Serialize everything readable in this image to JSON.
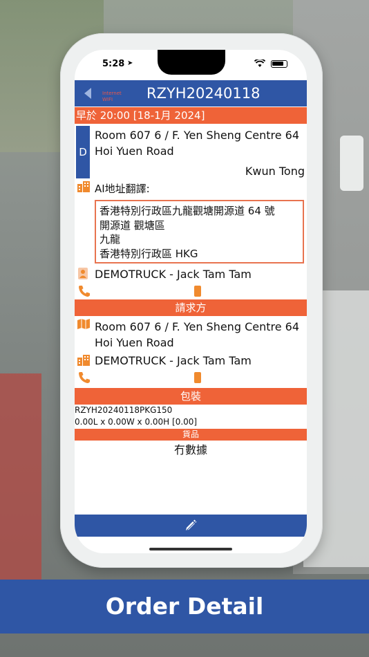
{
  "status_bar": {
    "time": "5:28"
  },
  "header": {
    "title": "RZYH20240118",
    "network_line1": "Internet",
    "network_line2": "WIFI"
  },
  "schedule": {
    "label": "早於 20:00 [18-1月 2024]"
  },
  "delivery": {
    "badge": "D",
    "address": "Room 607 6 / F. Yen Sheng Centre 64 Hoi Yuen Road",
    "district": "Kwun Tong",
    "ai_label": "AI地址翻譯:",
    "ai_lines": [
      "香港特別行政區九龍觀塘開源道 64 號",
      "開源道 觀塘區",
      "九龍",
      "香港特別行政區 HKG"
    ],
    "contact": "DEMOTRUCK - Jack Tam Tam"
  },
  "requester": {
    "header": "請求方",
    "address": "Room 607 6 / F. Yen Sheng Centre 64 Hoi Yuen Road",
    "contact": "DEMOTRUCK - Jack Tam Tam"
  },
  "packaging": {
    "header": "包裝",
    "id": "RZYH20240118PKG150",
    "dimensions": "0.00L x 0.00W x 0.00H [0.00]"
  },
  "goods": {
    "header": "貨品",
    "empty_text": "冇數據"
  },
  "caption": "Order Detail",
  "colors": {
    "primary": "#2f56a5",
    "accent": "#ef6338"
  }
}
